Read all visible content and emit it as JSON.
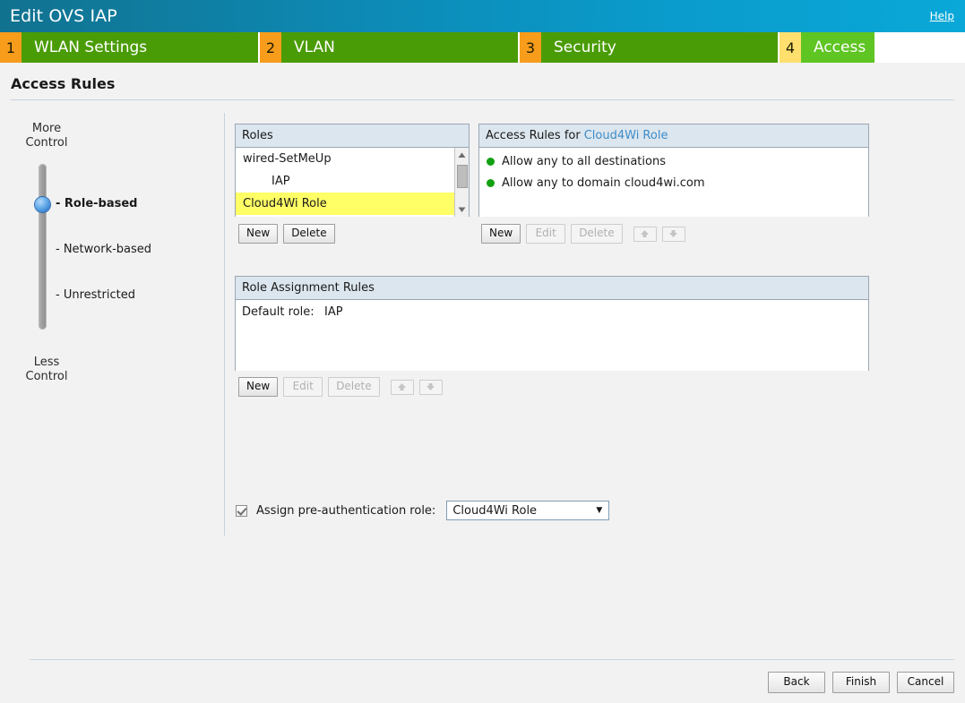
{
  "window": {
    "title": "Edit OVS IAP",
    "help_label": "Help"
  },
  "wizard": {
    "steps": [
      {
        "number": "1",
        "label": "WLAN Settings",
        "active": false
      },
      {
        "number": "2",
        "label": "VLAN",
        "active": false
      },
      {
        "number": "3",
        "label": "Security",
        "active": false
      },
      {
        "number": "4",
        "label": "Access",
        "active": true
      }
    ]
  },
  "page": {
    "heading": "Access Rules"
  },
  "slider": {
    "top_caption_line1": "More",
    "top_caption_line2": "Control",
    "bottom_caption_line1": "Less",
    "bottom_caption_line2": "Control",
    "options": [
      {
        "label": "- Role-based",
        "selected": true
      },
      {
        "label": "- Network-based",
        "selected": false
      },
      {
        "label": "- Unrestricted",
        "selected": false
      }
    ]
  },
  "roles_panel": {
    "header": "Roles",
    "items": [
      {
        "name": "wired-SetMeUp",
        "indent": false,
        "selected": false
      },
      {
        "name": "IAP",
        "indent": true,
        "selected": false
      },
      {
        "name": "Cloud4Wi Role",
        "indent": false,
        "selected": true
      }
    ],
    "buttons": [
      {
        "label": "New",
        "enabled": true
      },
      {
        "label": "Delete",
        "enabled": true
      }
    ]
  },
  "access_rules_panel": {
    "header_prefix": "Access Rules for",
    "header_role": "Cloud4Wi Role",
    "rules": [
      {
        "text": "Allow any to all destinations",
        "status_color": "#12a112"
      },
      {
        "text": "Allow any to domain cloud4wi.com",
        "status_color": "#12a112"
      }
    ],
    "buttons": [
      {
        "label": "New",
        "enabled": true
      },
      {
        "label": "Edit",
        "enabled": false
      },
      {
        "label": "Delete",
        "enabled": false
      }
    ],
    "arrow_buttons": [
      {
        "icon": "arrow-up-icon",
        "enabled": false
      },
      {
        "icon": "arrow-down-icon",
        "enabled": false
      }
    ]
  },
  "role_assignment_panel": {
    "header": "Role Assignment Rules",
    "rows": [
      {
        "label": "Default role:",
        "value": "IAP"
      }
    ],
    "buttons": [
      {
        "label": "New",
        "enabled": true
      },
      {
        "label": "Edit",
        "enabled": false
      },
      {
        "label": "Delete",
        "enabled": false
      }
    ],
    "arrow_buttons": [
      {
        "icon": "arrow-up-icon",
        "enabled": false
      },
      {
        "icon": "arrow-down-icon",
        "enabled": false
      }
    ]
  },
  "preauth": {
    "checked": true,
    "label": "Assign pre-authentication role:",
    "selected_role": "Cloud4Wi Role",
    "caret": "▼"
  },
  "footer": {
    "buttons": [
      {
        "label": "Back",
        "enabled": true
      },
      {
        "label": "Finish",
        "enabled": true
      },
      {
        "label": "Cancel",
        "enabled": true
      }
    ]
  },
  "colors": {
    "title_gradient_start": "#11728f",
    "title_gradient_end": "#09a8d8",
    "step_number_bg": "#f79c1b",
    "step_label_bg": "#4a9c07",
    "step_active_number_bg": "#ffdf6e",
    "step_active_label_bg": "#5ec523",
    "selection_highlight": "#ffff66",
    "panel_header_bg": "#dce6ee",
    "link_blue": "#3d8cc8",
    "status_green": "#12a112"
  }
}
